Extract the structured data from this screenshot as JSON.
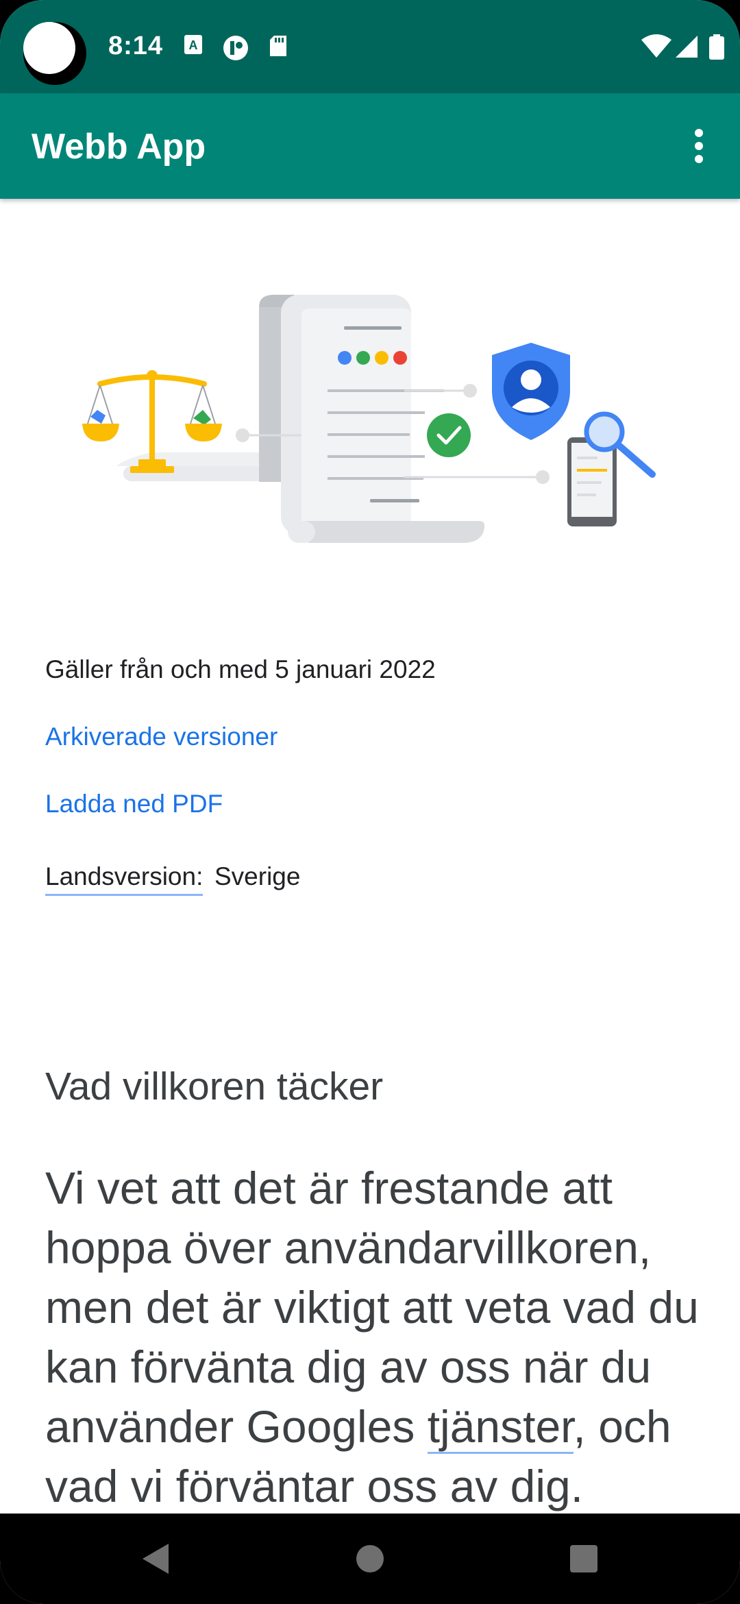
{
  "status_bar": {
    "time": "8:14",
    "icons": [
      "text-recognition-icon",
      "notification-icon",
      "sd-card-icon",
      "wifi-icon",
      "signal-icon",
      "battery-icon"
    ]
  },
  "app_bar": {
    "title": "Webb App",
    "menu_icon": "more-vert-icon"
  },
  "content": {
    "effective_date": "Gäller från och med 5 januari 2022",
    "links": {
      "archived": "Arkiverade versioner",
      "download_pdf": "Ladda ned PDF"
    },
    "country": {
      "label": "Landsversion:",
      "value": "Sverige"
    },
    "section_heading": "Vad villkoren täcker",
    "intro": {
      "part1": "Vi vet att det är frestande att hoppa över användarvillkoren, men det är viktigt att veta vad du kan förvänta dig av oss när du använder Googles ",
      "services_link": "tjänster",
      "part2": ", och vad vi förväntar oss av dig."
    }
  },
  "nav_bar": {
    "back": "back-icon",
    "home": "home-icon",
    "recents": "recents-icon"
  },
  "colors": {
    "status_bar": "#00665b",
    "app_bar": "#008577",
    "link": "#1a73e8",
    "link_underline": "#8ab4f8",
    "heading": "#3c4043"
  }
}
